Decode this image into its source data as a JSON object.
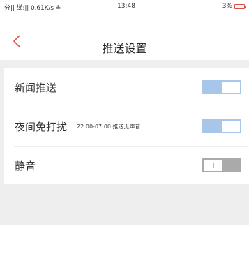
{
  "status_bar": {
    "signal_text": "分|| 绨:|| 0.61K/s ≗",
    "time": "13:48",
    "battery_text": "3%",
    "battery_level": 0.03,
    "battery_color": "#e24a4a"
  },
  "navbar": {
    "back_icon": "chevron-left-icon",
    "title": "推送设置"
  },
  "settings": [
    {
      "label": "新闻推送",
      "note": "",
      "toggle_on": true
    },
    {
      "label": "夜间免打扰",
      "note": "22:00-07:00 推送无声音",
      "toggle_on": true
    },
    {
      "label": "静音",
      "note": "",
      "toggle_on": false
    }
  ],
  "colors": {
    "accent": "#e0504d",
    "toggle_on": "#a8c6ea",
    "toggle_off": "#aaaaaa",
    "background_gray": "#eeeeee"
  }
}
